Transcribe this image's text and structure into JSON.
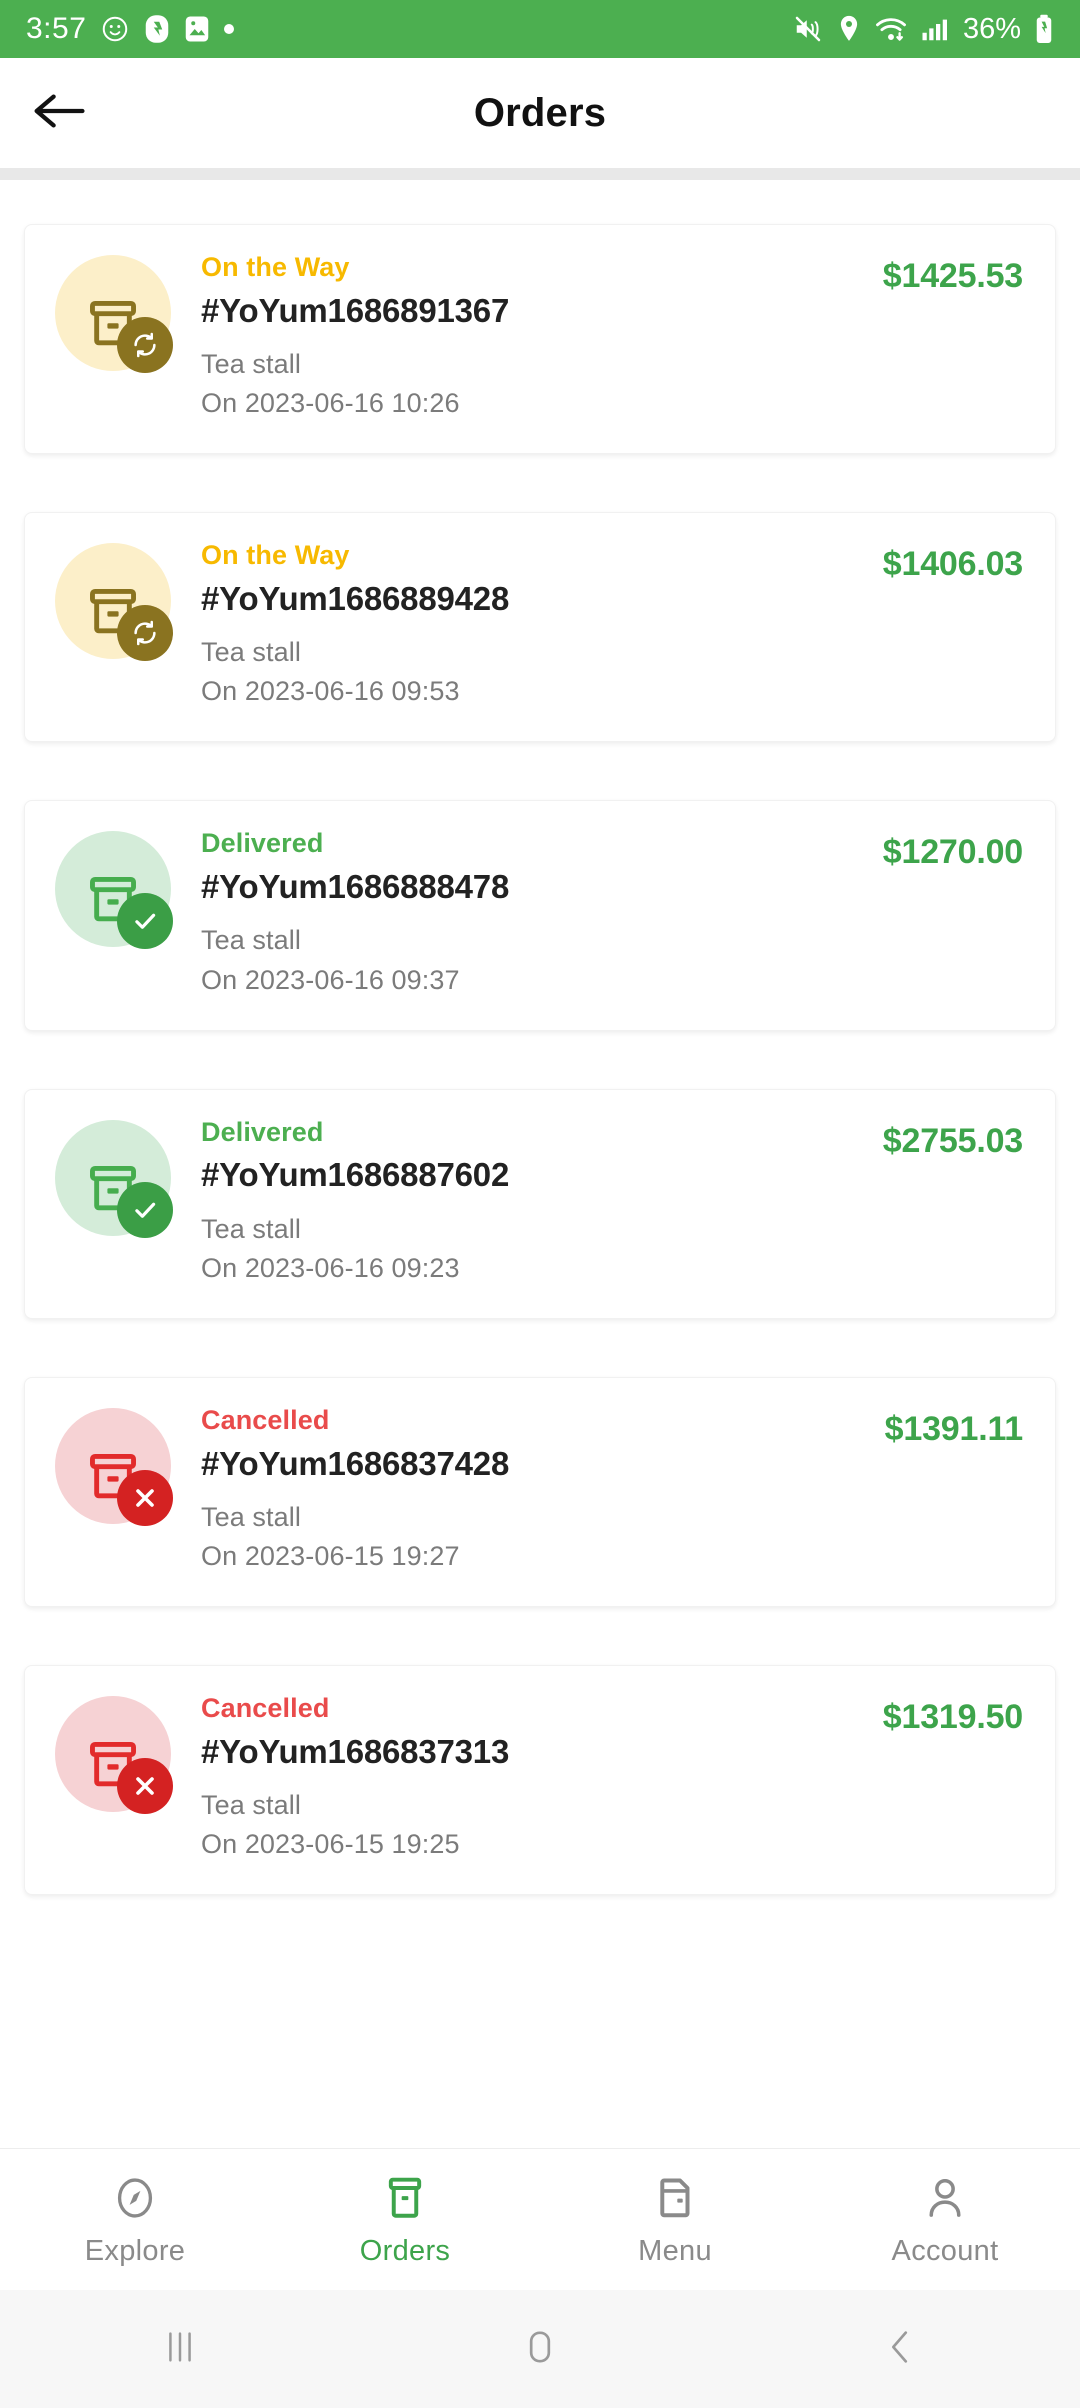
{
  "status_bar": {
    "time": "3:57",
    "battery": "36%",
    "icons_left": [
      "emoji-smiley-icon",
      "screenshot-icon",
      "image-icon",
      "dot-indicator-icon"
    ],
    "icons_right": [
      "mute-icon",
      "location-icon",
      "wifi-icon",
      "signal-icon",
      "battery-charging-icon"
    ],
    "background": "#4CAF50"
  },
  "app_bar": {
    "back_icon": "arrow-left-icon",
    "title": "Orders"
  },
  "colors": {
    "brand_green": "#3da44b",
    "on_the_way": "#f7b900",
    "delivered": "#4caf50",
    "cancelled": "#e94b4b",
    "amount": "#3da44b"
  },
  "orders": [
    {
      "status": "On the Way",
      "status_key": "on-the-way",
      "order_id": "#YoYum1686891367",
      "vendor": "Tea stall",
      "placed_on": "On 2023-06-16 10:26",
      "amount": "$1425.53",
      "badge_icon": "sync-icon",
      "circle_bg": "#fcefc9",
      "icon_color": "#8a7320",
      "badge_bg": "#8a7320"
    },
    {
      "status": "On the Way",
      "status_key": "on-the-way",
      "order_id": "#YoYum1686889428",
      "vendor": "Tea stall",
      "placed_on": "On 2023-06-16 09:53",
      "amount": "$1406.03",
      "badge_icon": "sync-icon",
      "circle_bg": "#fcefc9",
      "icon_color": "#8a7320",
      "badge_bg": "#8a7320"
    },
    {
      "status": "Delivered",
      "status_key": "delivered",
      "order_id": "#YoYum1686888478",
      "vendor": "Tea stall",
      "placed_on": "On 2023-06-16 09:37",
      "amount": "$1270.00",
      "badge_icon": "check-icon",
      "circle_bg": "#d4ecd9",
      "icon_color": "#46ad4e",
      "badge_bg": "#3b9e46"
    },
    {
      "status": "Delivered",
      "status_key": "delivered",
      "order_id": "#YoYum1686887602",
      "vendor": "Tea stall",
      "placed_on": "On 2023-06-16 09:23",
      "amount": "$2755.03",
      "badge_icon": "check-icon",
      "circle_bg": "#d4ecd9",
      "icon_color": "#46ad4e",
      "badge_bg": "#3b9e46"
    },
    {
      "status": "Cancelled",
      "status_key": "cancelled",
      "order_id": "#YoYum1686837428",
      "vendor": "Tea stall",
      "placed_on": "On 2023-06-15 19:27",
      "amount": "$1391.11",
      "badge_icon": "close-icon",
      "circle_bg": "#f6d2d4",
      "icon_color": "#e22b2b",
      "badge_bg": "#d42222"
    },
    {
      "status": "Cancelled",
      "status_key": "cancelled",
      "order_id": "#YoYum1686837313",
      "vendor": "Tea stall",
      "placed_on": "On 2023-06-15 19:25",
      "amount": "$1319.50",
      "badge_icon": "close-icon",
      "circle_bg": "#f6d2d4",
      "icon_color": "#e22b2b",
      "badge_bg": "#d42222"
    }
  ],
  "bottom_nav": {
    "items": [
      {
        "label": "Explore",
        "icon": "compass-icon",
        "active": false
      },
      {
        "label": "Orders",
        "icon": "box-icon",
        "active": true
      },
      {
        "label": "Menu",
        "icon": "menu-card-icon",
        "active": false
      },
      {
        "label": "Account",
        "icon": "person-icon",
        "active": false
      }
    ]
  },
  "system_nav": {
    "items": [
      {
        "icon": "recents-icon"
      },
      {
        "icon": "home-icon"
      },
      {
        "icon": "back-icon"
      }
    ]
  }
}
